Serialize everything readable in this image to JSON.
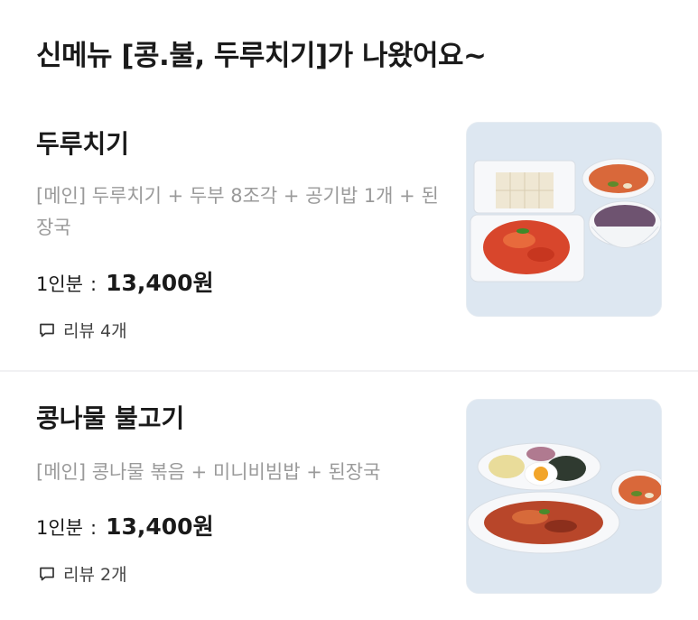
{
  "header": {
    "title": "신메뉴 [콩.불, 두루치기]가 나왔어요~"
  },
  "items": [
    {
      "name": "두루치기",
      "description": "[메인] 두루치기 + 두부 8조각 + 공기밥 1개 + 된장국",
      "price_label": "1인분",
      "price_sep": ":",
      "price": "13,400원",
      "review_label": "리뷰 4개",
      "image_alt": "두루치기 세트 사진"
    },
    {
      "name": "콩나물 불고기",
      "description": "[메인] 콩나물 볶음 + 미니비빔밥 + 된장국",
      "price_label": "1인분",
      "price_sep": ":",
      "price": "13,400원",
      "review_label": "리뷰 2개",
      "image_alt": "콩나물 불고기 세트 사진"
    }
  ],
  "colors": {
    "text": "#1a1a1a",
    "muted": "#9a9a9a",
    "divider": "#f1f1f3",
    "thumb_bg": "#dfe8f2"
  }
}
